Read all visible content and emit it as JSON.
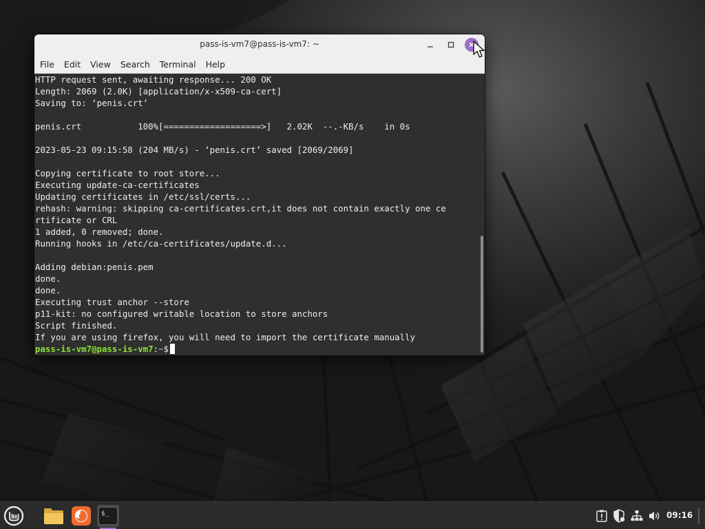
{
  "window": {
    "title": "pass-is-vm7@pass-is-vm7: ~",
    "minimize_icon": "minimize-icon",
    "maximize_icon": "maximize-icon",
    "close_icon": "close-icon",
    "accent_color": "#9b6ec8"
  },
  "menubar": {
    "items": [
      "File",
      "Edit",
      "View",
      "Search",
      "Terminal",
      "Help"
    ]
  },
  "terminal": {
    "lines": [
      "HTTP request sent, awaiting response... 200 OK",
      "Length: 2069 (2.0K) [application/x-x509-ca-cert]",
      "Saving to: ‘penis.crt’",
      "",
      "penis.crt           100%[===================>]   2.02K  --.-KB/s    in 0s",
      "",
      "2023-05-23 09:15:58 (204 MB/s) - ‘penis.crt’ saved [2069/2069]",
      "",
      "Copying certificate to root store...",
      "Executing update-ca-certificates",
      "Updating certificates in /etc/ssl/certs...",
      "rehash: warning: skipping ca-certificates.crt,it does not contain exactly one ce",
      "rtificate or CRL",
      "1 added, 0 removed; done.",
      "Running hooks in /etc/ca-certificates/update.d...",
      "",
      "Adding debian:penis.pem",
      "done.",
      "done.",
      "Executing trust anchor --store",
      "p11-kit: no configured writable location to store anchors",
      "Script finished.",
      "If you are using firefox, you will need to import the certificate manually"
    ],
    "prompt_user": "pass-is-vm7@pass-is-vm7",
    "prompt_sep": ":",
    "prompt_path": "~",
    "prompt_symbol": "$",
    "prompt_user_color": "#8ae234",
    "prompt_path_color": "#729fcf"
  },
  "taskbar": {
    "menu_icon": "linux-mint-menu-icon",
    "apps": [
      {
        "icon": "files-folder-icon"
      },
      {
        "icon": "firefox-icon"
      },
      {
        "icon": "terminal-icon",
        "active": true
      }
    ],
    "tray": [
      "notification-icon",
      "shield-update-icon",
      "network-icon",
      "volume-icon"
    ],
    "clock": "09:16"
  }
}
